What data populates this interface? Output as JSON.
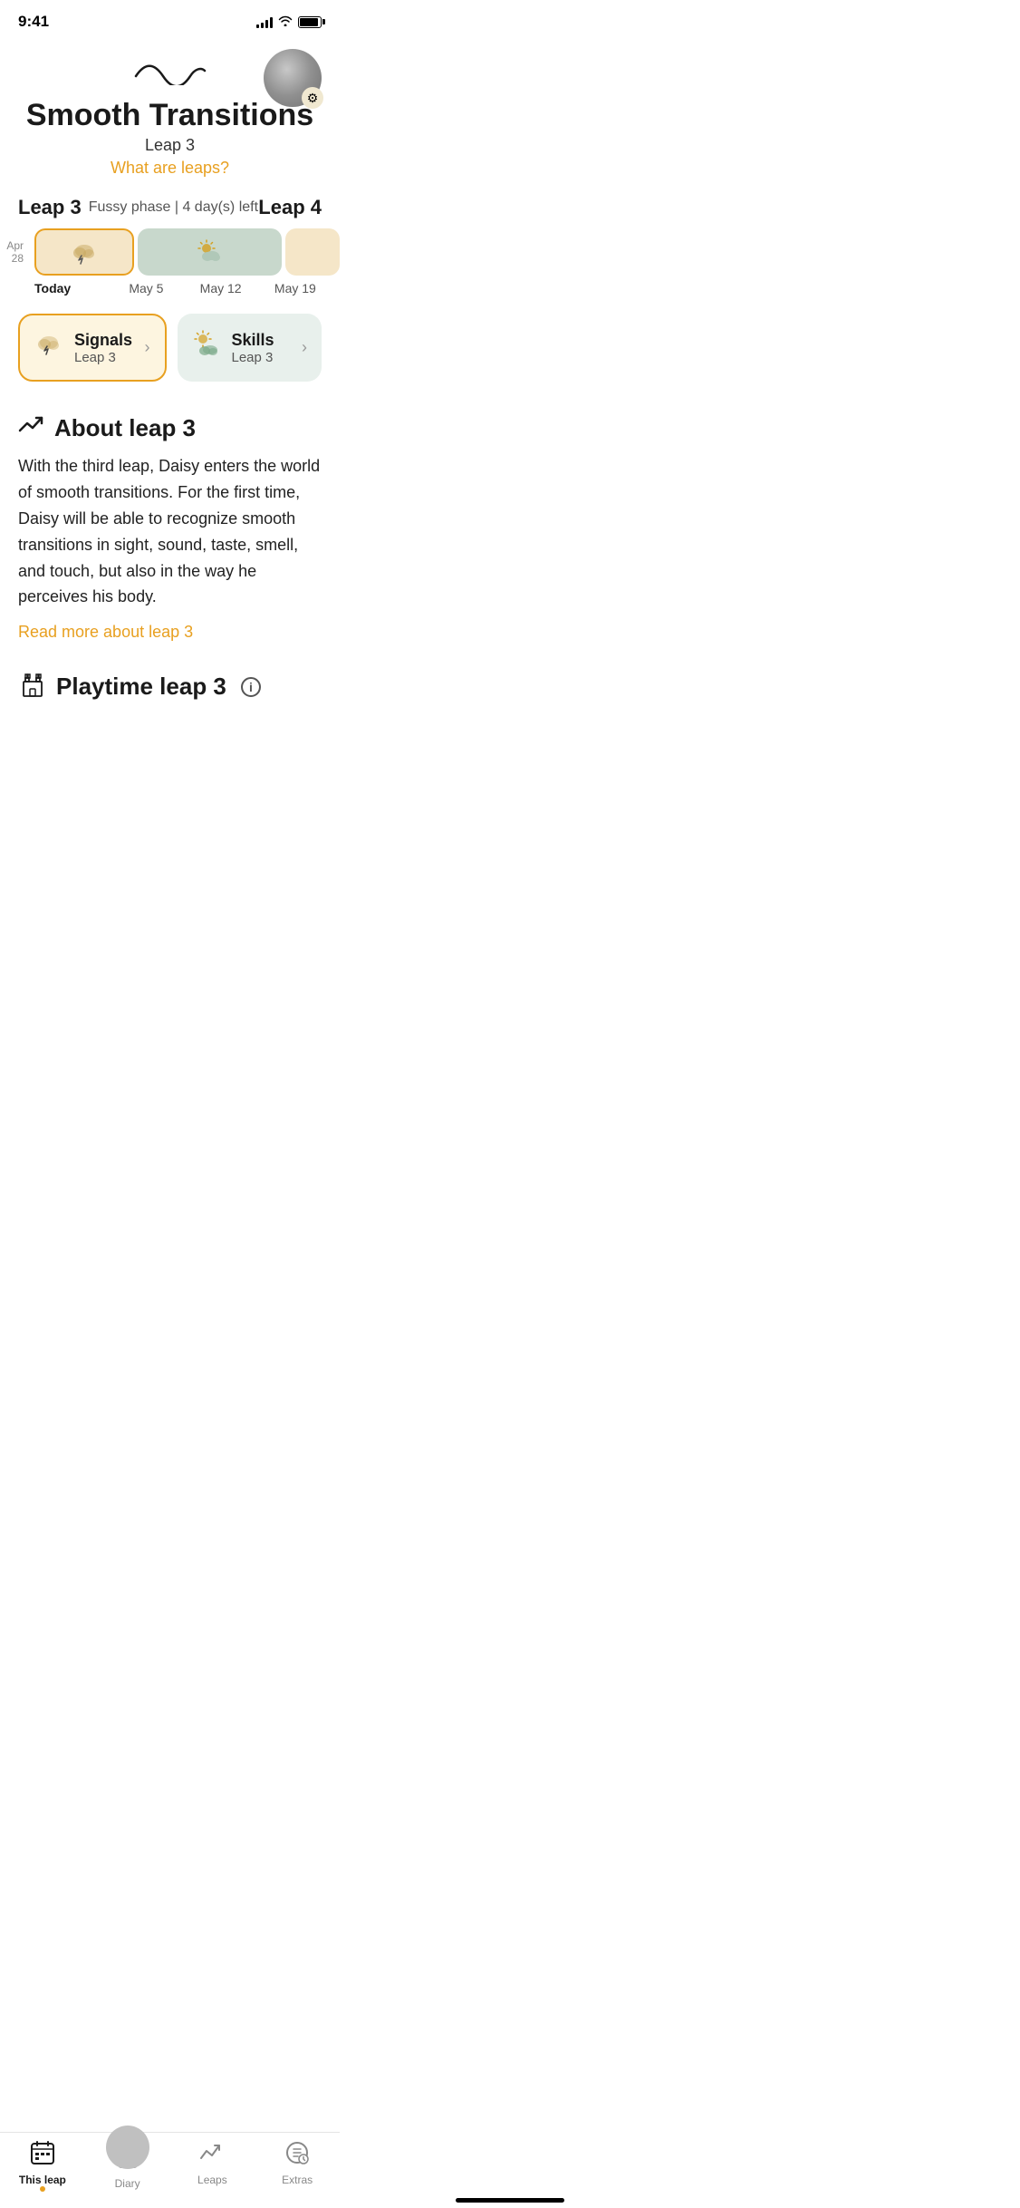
{
  "statusBar": {
    "time": "9:41",
    "moonIcon": "🌙"
  },
  "header": {
    "waveLabel": "wave icon",
    "title": "Smooth Transitions",
    "subtitle": "Leap 3",
    "whatAreLeaps": "What are leaps?",
    "avatarLabel": "user avatar",
    "gearLabel": "⚙"
  },
  "leapInfo": {
    "currentLeap": "Leap 3",
    "fussyPhase": "Fussy phase | 4 day(s) left",
    "nextLeap": "Leap 4"
  },
  "timeline": {
    "dates": [
      "Today",
      "May 5",
      "May 12",
      "May 19"
    ],
    "prevLabel": "Apr 28"
  },
  "cards": {
    "signals": {
      "title": "Signals",
      "subtitle": "Leap 3",
      "arrow": "›"
    },
    "skills": {
      "title": "Skills",
      "subtitle": "Leap 3",
      "arrow": "›"
    }
  },
  "aboutSection": {
    "title": "About leap 3",
    "body": "With the third leap, Daisy  enters the world of smooth transitions. For the first time, Daisy will be able to recognize smooth transitions in sight, sound, taste, smell, and touch, but also in the way he perceives his body.",
    "readMore": "Read more about leap 3"
  },
  "playtimeSection": {
    "title": "Playtime leap 3",
    "infoIcon": "i"
  },
  "bottomNav": {
    "items": [
      {
        "label": "This leap",
        "active": true,
        "hasDot": true
      },
      {
        "label": "Diary",
        "active": false,
        "hasDot": false
      },
      {
        "label": "Leaps",
        "active": false,
        "hasDot": false
      },
      {
        "label": "Extras",
        "active": false,
        "hasDot": false
      }
    ]
  }
}
